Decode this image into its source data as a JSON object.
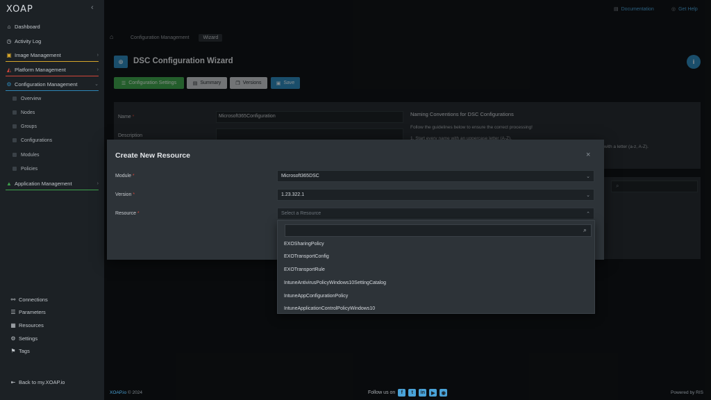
{
  "app": {
    "logo_main": "XOAP",
    "logo_tail": ""
  },
  "header": {
    "documentation": "Documentation",
    "get_help": "Get Help"
  },
  "sidebar": {
    "items": [
      {
        "label": "Dashboard",
        "icon": "dashboard-icon"
      },
      {
        "label": "Activity Log",
        "icon": "clock-icon"
      },
      {
        "label": "Image Management",
        "icon": "image-icon",
        "underline": "#d6a72b"
      },
      {
        "label": "Platform Management",
        "icon": "platform-icon",
        "underline": "#d2463a"
      },
      {
        "label": "Configuration Management",
        "icon": "config-icon",
        "underline": "#2e87b8"
      }
    ],
    "sub_items": [
      "Overview",
      "Nodes",
      "Groups",
      "Configurations",
      "Modules",
      "Policies"
    ],
    "application": {
      "label": "Application Management",
      "underline": "#3fa34d"
    },
    "bottom": [
      "Connections",
      "Parameters",
      "Resources",
      "Settings",
      "Tags"
    ],
    "back": "Back to my.XOAP.io"
  },
  "breadcrumb": {
    "section": "Configuration Management",
    "current": "Wizard"
  },
  "page": {
    "title": "DSC Configuration Wizard"
  },
  "toolbar": {
    "config_settings": "Configuration Settings",
    "summary": "Summary",
    "versions": "Versions",
    "save": "Save"
  },
  "form": {
    "name_label": "Name",
    "name_value": "Microsoft365Configuration",
    "description_label": "Description"
  },
  "note": {
    "title": "Naming Conventions for DSC Configurations",
    "line1": "Follow the guidelines below to ensure the correct processing!",
    "line2": "1. Start every name with an uppercase letter (A-Z).",
    "line3": "with a letter (a-z, A-Z)."
  },
  "modal": {
    "title": "Create New Resource",
    "module_label": "Module",
    "module_value": "Microsoft365DSC",
    "version_label": "Version",
    "version_value": "1.23.322.1",
    "resource_label": "Resource",
    "resource_placeholder": "Select a Resource"
  },
  "dropdown": {
    "items": [
      "EXOSharingPolicy",
      "EXOTransportConfig",
      "EXOTransportRule",
      "IntuneAntivirusPolicyWindows10SettingCatalog",
      "IntuneAppConfigurationPolicy",
      "IntuneApplicationControlPolicyWindows10"
    ]
  },
  "footer": {
    "brand": "XOAP.io",
    "copyright": "© 2024",
    "follow": "Follow us on",
    "powered": "Powered by RIS"
  },
  "colors": {
    "accent": "#2e87b8",
    "success": "#3fa34d",
    "danger": "#d2463a",
    "warning": "#d6a72b"
  }
}
